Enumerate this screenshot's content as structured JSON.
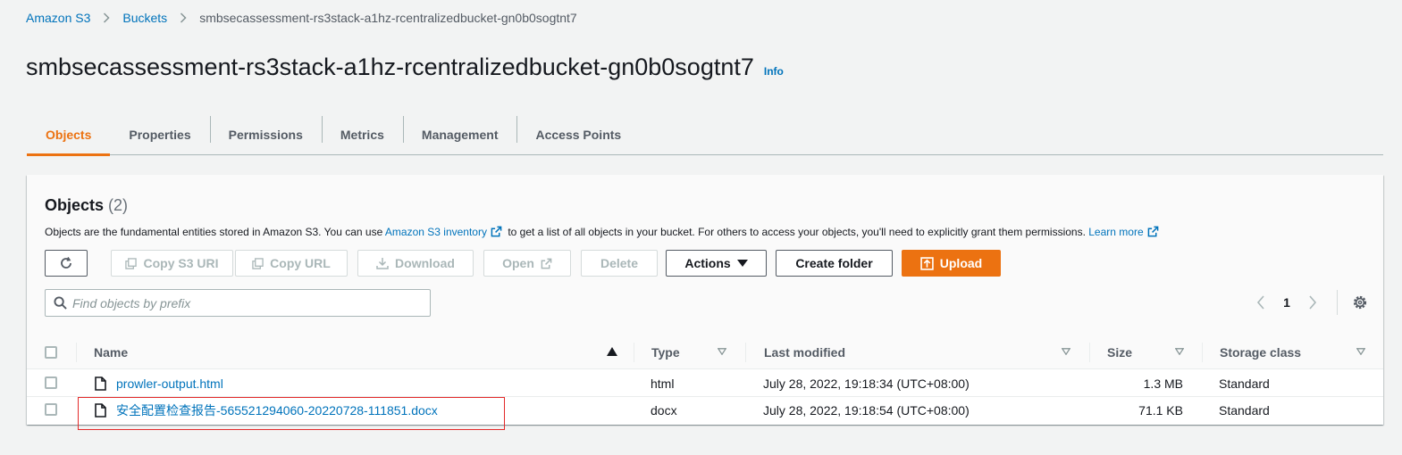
{
  "breadcrumb": {
    "items": [
      "Amazon S3",
      "Buckets"
    ],
    "current": "smbsecassessment-rs3stack-a1hz-rcentralizedbucket-gn0b0sogtnt7"
  },
  "page": {
    "title": "smbsecassessment-rs3stack-a1hz-rcentralizedbucket-gn0b0sogtnt7",
    "info": "Info"
  },
  "tabs": [
    "Objects",
    "Properties",
    "Permissions",
    "Metrics",
    "Management",
    "Access Points"
  ],
  "objects_panel": {
    "title": "Objects",
    "count": "(2)",
    "desc_part1": "Objects are the fundamental entities stored in Amazon S3. You can use ",
    "inventory_link": "Amazon S3 inventory",
    "desc_part2": " to get a list of all objects in your bucket. For others to access your objects, you'll need to explicitly grant them permissions. ",
    "learn_more": "Learn more"
  },
  "toolbar": {
    "copy_s3_uri": "Copy S3 URI",
    "copy_url": "Copy URL",
    "download": "Download",
    "open": "Open",
    "delete": "Delete",
    "actions": "Actions",
    "create_folder": "Create folder",
    "upload": "Upload"
  },
  "search": {
    "placeholder": "Find objects by prefix"
  },
  "pagination": {
    "page": "1"
  },
  "table": {
    "columns": [
      "Name",
      "Type",
      "Last modified",
      "Size",
      "Storage class"
    ],
    "rows": [
      {
        "name": "prowler-output.html",
        "type": "html",
        "last_modified": "July 28, 2022, 19:18:34 (UTC+08:00)",
        "size": "1.3 MB",
        "storage_class": "Standard"
      },
      {
        "name": "安全配置检查报告-565521294060-20220728-111851.docx",
        "type": "docx",
        "last_modified": "July 28, 2022, 19:18:54 (UTC+08:00)",
        "size": "71.1 KB",
        "storage_class": "Standard"
      }
    ]
  },
  "colors": {
    "accent": "#ec7211",
    "link": "#0073bb",
    "highlight": "#e32a2a"
  }
}
